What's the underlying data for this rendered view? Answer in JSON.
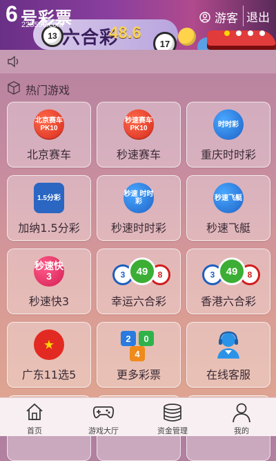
{
  "header": {
    "logo_number": "6",
    "logo_text": "号彩票",
    "logo_domain": "225599.com",
    "guest_label": "游客",
    "logout_label": "退出",
    "banner": {
      "title": "六合彩",
      "value": "48.6",
      "ball_numbers": [
        "13",
        "17"
      ],
      "carousel_dots": 4,
      "active_dot_index": 0
    }
  },
  "notice": {
    "icon": "speaker-icon"
  },
  "section": {
    "title": "热门游戏",
    "icon": "cube-icon"
  },
  "games": [
    {
      "label": "北京赛车",
      "icon_text": "北京赛车 PK10"
    },
    {
      "label": "秒速赛车",
      "icon_text": "秒速赛车 PK10"
    },
    {
      "label": "重庆时时彩",
      "icon_text": "时时彩"
    },
    {
      "label": "加纳1.5分彩",
      "icon_text": "1.5分彩"
    },
    {
      "label": "秒速时时彩",
      "icon_text": "秒速 时时彩"
    },
    {
      "label": "秒速飞艇",
      "icon_text": "秒速飞艇"
    },
    {
      "label": "秒速快3",
      "icon_text": "秒速快3"
    },
    {
      "label": "幸运六合彩",
      "icon_numbers": [
        "3",
        "49",
        "8"
      ]
    },
    {
      "label": "香港六合彩",
      "icon_numbers": [
        "3",
        "49",
        "8"
      ]
    },
    {
      "label": "广东11选5",
      "icon_text": "★"
    },
    {
      "label": "更多彩票",
      "icon_numbers": [
        "2",
        "0",
        "4"
      ]
    },
    {
      "label": "在线客服",
      "icon": "customer-service-icon"
    }
  ],
  "bottom_nav": [
    {
      "label": "首页",
      "icon": "home-icon"
    },
    {
      "label": "游戏大厅",
      "icon": "gamepad-icon"
    },
    {
      "label": "资金管理",
      "icon": "coins-icon"
    },
    {
      "label": "我的",
      "icon": "user-icon"
    }
  ],
  "colors": {
    "accent": "#d62a1d",
    "header_bg": "#8a3f9e",
    "nav_bg": "#f8eff2",
    "dot_active": "#ffd600"
  }
}
